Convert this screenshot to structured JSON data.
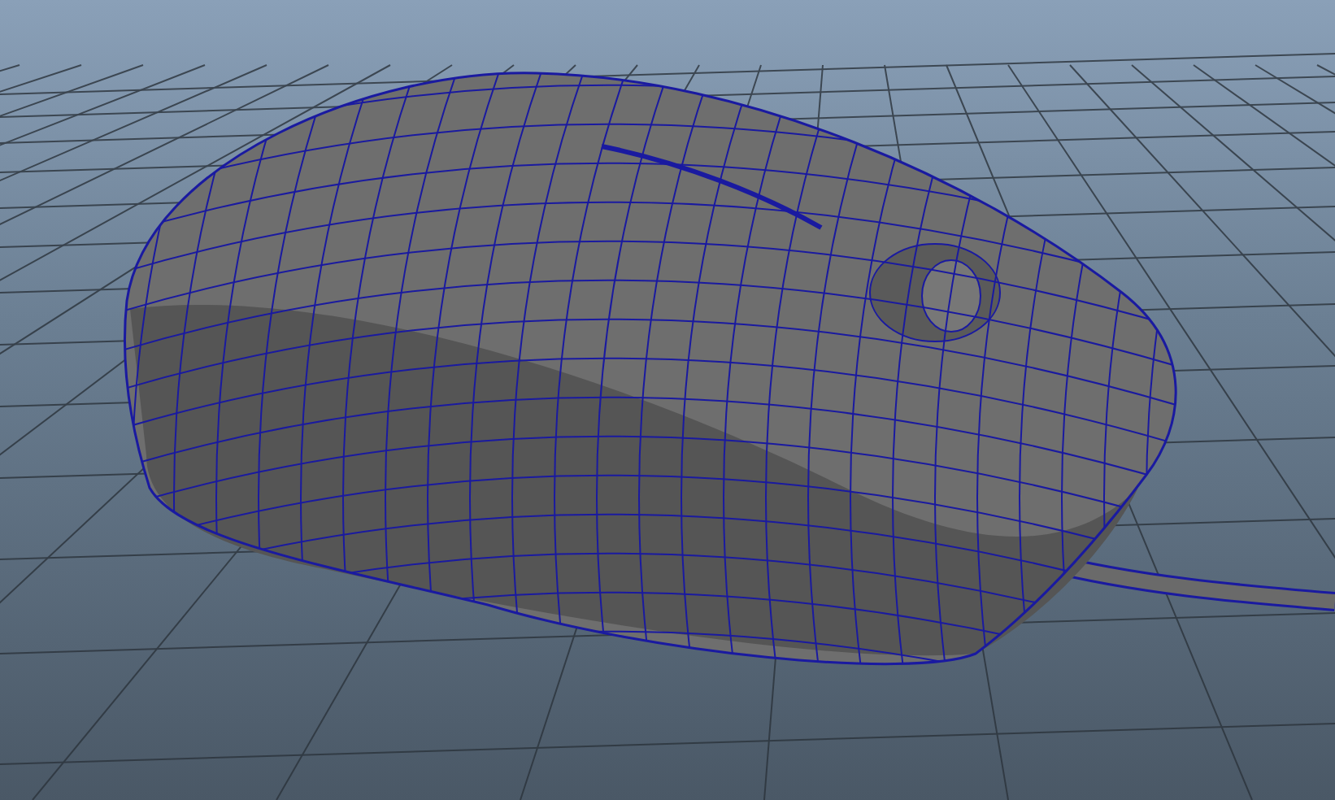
{
  "viewport": {
    "grid_visible": true,
    "wireframe_on_shaded": true
  }
}
